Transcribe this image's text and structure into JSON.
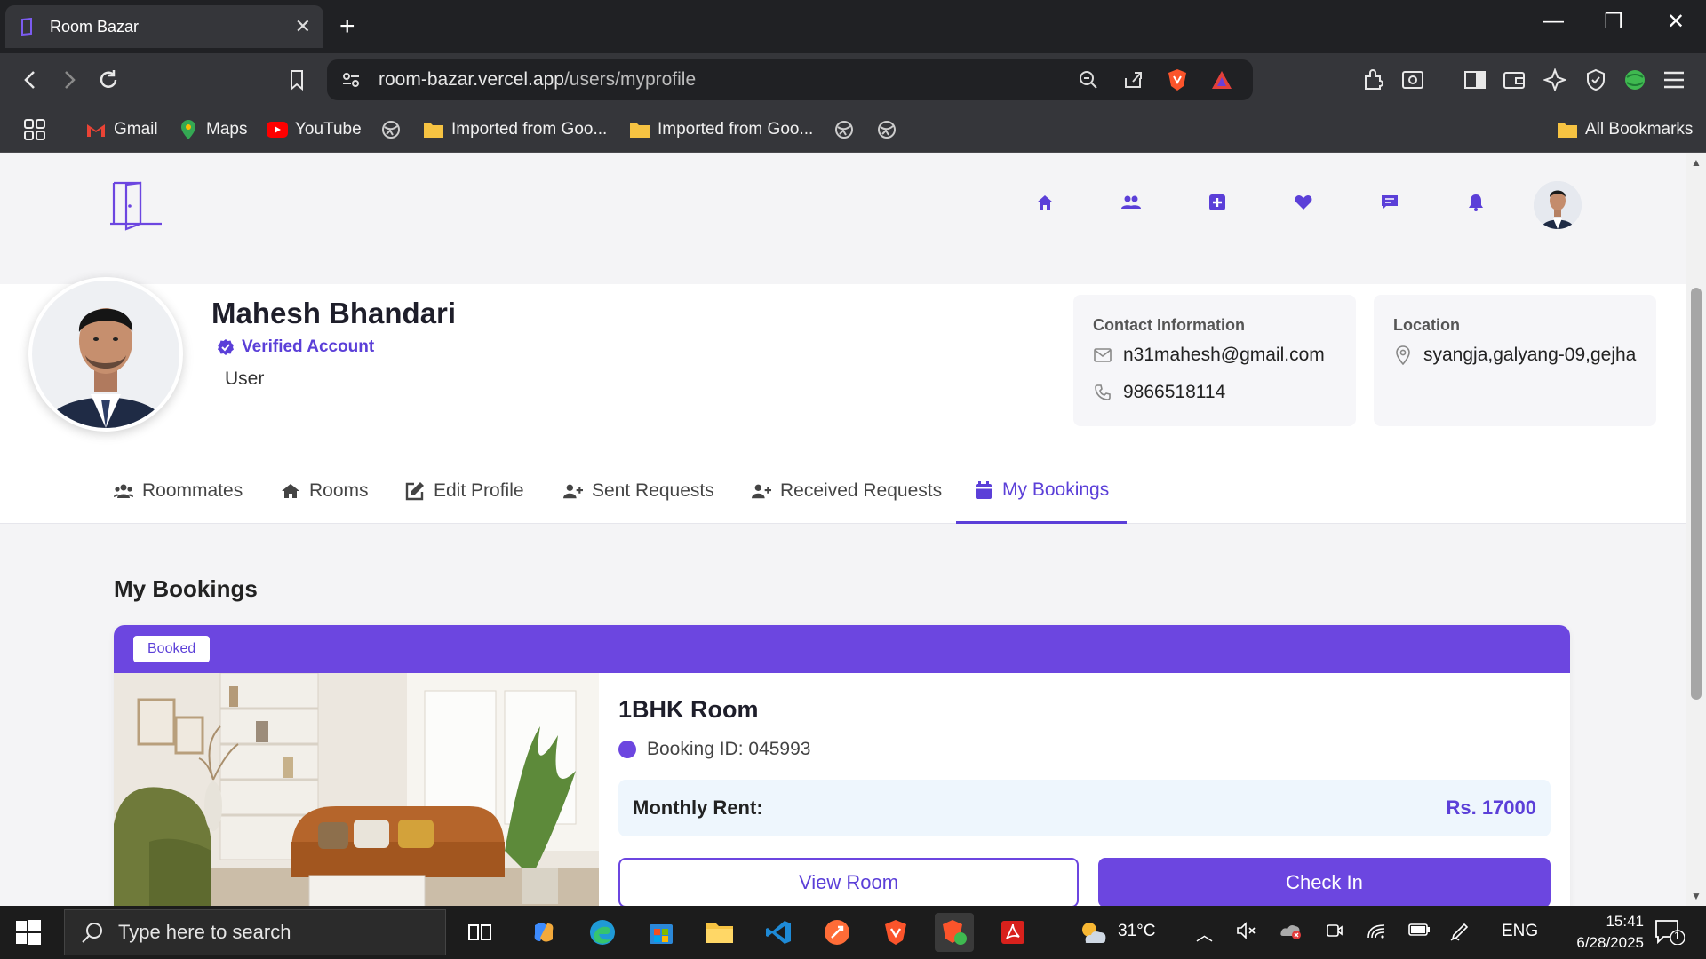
{
  "browser": {
    "tab_title": "Room Bazar",
    "url_host": "room-bazar.vercel.app",
    "url_path": "/users/myprofile",
    "bookmarks": [
      {
        "label": "Gmail",
        "icon": "gmail-icon"
      },
      {
        "label": "Maps",
        "icon": "maps-icon"
      },
      {
        "label": "YouTube",
        "icon": "youtube-icon"
      },
      {
        "label": "Imported from Goo...",
        "icon": "folder-icon"
      },
      {
        "label": "Imported from Goo...",
        "icon": "folder-icon"
      }
    ],
    "all_bookmarks": "All Bookmarks"
  },
  "site": {
    "brand_color": "#6c46e0",
    "nav_icons": [
      "home-icon",
      "users-icon",
      "add-icon",
      "heart-icon",
      "chat-icon",
      "bell-icon"
    ]
  },
  "profile": {
    "name": "Mahesh Bhandari",
    "verified": "Verified Account",
    "role": "User",
    "contact_heading": "Contact Information",
    "email": "n31mahesh@gmail.com",
    "phone": "9866518114",
    "location_heading": "Location",
    "location": "syangja,galyang-09,gejha"
  },
  "tabs": [
    {
      "label": "Roommates",
      "icon": "users-icon"
    },
    {
      "label": "Rooms",
      "icon": "home-icon"
    },
    {
      "label": "Edit Profile",
      "icon": "edit-icon"
    },
    {
      "label": "Sent Requests",
      "icon": "user-plus-icon"
    },
    {
      "label": "Received Requests",
      "icon": "user-plus-icon"
    },
    {
      "label": "My Bookings",
      "icon": "calendar-icon",
      "active": true
    }
  ],
  "bookings": {
    "title": "My Bookings",
    "items": [
      {
        "status": "Booked",
        "room_title": "1BHK Room",
        "booking_id": "Booking ID: 045993",
        "rent_label": "Monthly Rent:",
        "rent_value": "Rs. 17000",
        "view_label": "View Room",
        "checkin_label": "Check In"
      }
    ]
  },
  "taskbar": {
    "search_placeholder": "Type here to search",
    "weather": "31°C",
    "lang": "ENG",
    "time": "15:41",
    "date": "6/28/2025",
    "notif_count": "1"
  }
}
